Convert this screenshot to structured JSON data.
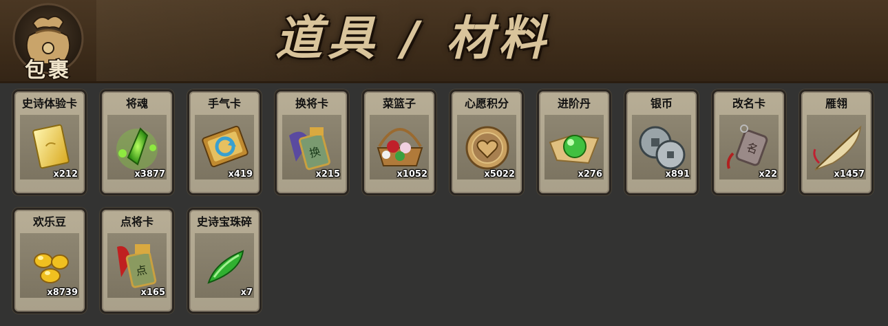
{
  "header": {
    "bag_label": "包裹",
    "title": "道具 / 材料"
  },
  "items": [
    {
      "name": "史诗体验卡",
      "count": "x212",
      "icon": "gold-card-icon"
    },
    {
      "name": "将魂",
      "count": "x3877",
      "icon": "green-crystal-icon"
    },
    {
      "name": "手气卡",
      "count": "x419",
      "icon": "refresh-card-icon"
    },
    {
      "name": "换将卡",
      "count": "x215",
      "icon": "swap-general-token-icon"
    },
    {
      "name": "菜篮子",
      "count": "x1052",
      "icon": "flower-basket-icon"
    },
    {
      "name": "心愿积分",
      "count": "x5022",
      "icon": "heart-coin-icon"
    },
    {
      "name": "进阶丹",
      "count": "x276",
      "icon": "green-pill-icon"
    },
    {
      "name": "银币",
      "count": "x891",
      "icon": "silver-coin-icon"
    },
    {
      "name": "改名卡",
      "count": "x22",
      "icon": "rename-tag-icon"
    },
    {
      "name": "雁翎",
      "count": "x1457",
      "icon": "feather-icon"
    },
    {
      "name": "欢乐豆",
      "count": "x8739",
      "icon": "gold-beans-icon"
    },
    {
      "name": "点将卡",
      "count": "x165",
      "icon": "general-token-icon"
    },
    {
      "name": "史诗宝珠碎",
      "count": "x7",
      "icon": "green-shard-icon"
    }
  ]
}
